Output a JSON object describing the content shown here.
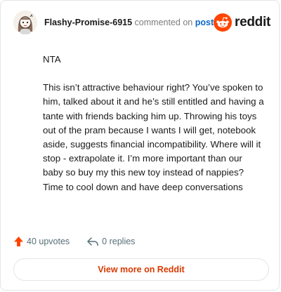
{
  "comment": {
    "username": "Flashy-Promise-6915",
    "commented_text": "commented on",
    "post_link": "post",
    "brand": "reddit",
    "paragraphs": [
      "NTA",
      "This isn’t attractive behaviour right? You’ve spoken to him, talked about it and he’s still entitled and having a tante with friends backing him up. Throwing his toys out of the pram because I wants I will get, notebook aside, suggests financial incompatibility. Where will it stop - extrapolate it. I’m more important than our baby so buy my this new toy instead of nappies? Time to cool down and have deep conversations"
    ]
  },
  "actions": {
    "upvotes": "40 upvotes",
    "replies": "0 replies"
  },
  "footer": {
    "view_more_label": "View more on Reddit"
  },
  "colors": {
    "accent": "#ff4500",
    "link": "#0b67c9",
    "view_more": "#d93a00"
  },
  "icons": [
    "avatar",
    "reddit-logo-icon",
    "upvote-arrow-icon",
    "reply-icon"
  ]
}
